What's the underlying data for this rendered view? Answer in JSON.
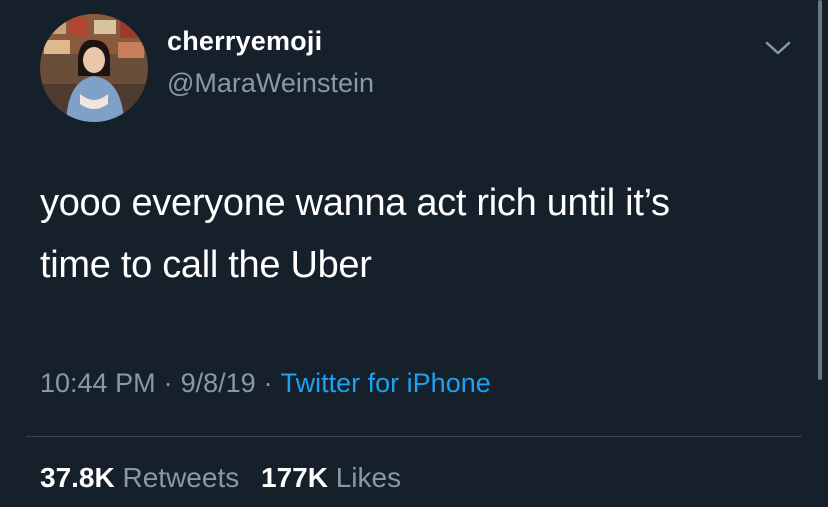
{
  "author": {
    "display_name": "cherryemoji",
    "handle": "@MaraWeinstein",
    "avatar": "profile-photo"
  },
  "tweet": {
    "text_line1": "yooo everyone wanna act rich until it’s",
    "text_line2": "time to call the Uber"
  },
  "meta": {
    "time": "10:44 PM",
    "date": "9/8/19",
    "separator": "·",
    "source": "Twitter for iPhone"
  },
  "stats": {
    "retweets_count": "37.8K",
    "retweets_label": "Retweets",
    "likes_count": "177K",
    "likes_label": "Likes"
  },
  "icons": {
    "menu": "chevron-down-icon"
  },
  "colors": {
    "background": "#15202b",
    "secondary_text": "#8899a6",
    "link": "#1da1f2",
    "divider": "#38444d"
  }
}
